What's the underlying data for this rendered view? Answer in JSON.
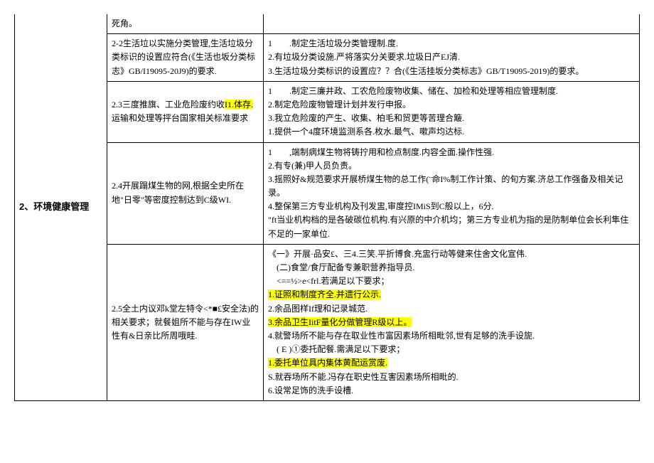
{
  "category": "2、环境健康管理",
  "rows": [
    {
      "left": "死角。",
      "right": ""
    },
    {
      "left": "2-2生活垃以实施分类管理,生活垃圾分类标识的设置应符合(《生活也坂分类标志》GB/I19095-20J9)的要求.",
      "right": "1　　.制定生活垃圾分类管理制.度.\n2.有垃圾分类设施.严将落实分关要求.垃圾日产EJ清.\n3.生活垃圾分类标识的设置应？？合(《生活挂坂分类标志》GB/T19095-2019)的要求。"
    },
    {
      "left_pre": "2.3三度推旗、工业危险废约收",
      "left_hl": "I1.体存.",
      "left_post": "运输和处理等抨台国家相关标准要求",
      "right": "1　　.制定三廉井政、工农危险废物收集、储在、加检和处理等相应管理制度.\n2.制定危险废物管理计划并发行申报。\n3.我立危险废的产生、收集、柏毛和贸更等苦理合簸.\n1.提供一个4度环境监测系各.枚水.最气、嗽声均达标."
    },
    {
      "left": "2.4开展蹋煤生物的网,根据全史所在地\"日零\"等密度控制达到C级WI.",
      "right": "1　　,端制病煤生物将铸拧用和检点制度.内容全面.操作性强.\n2.有专(兼)甲人员负责。\n3.摇照好&规范要求开展桥煤生物的总工作(¨命I%制工作计策、的旬方案.济总工作强备及相关记录。\n4.整保第三方专业机构及刊发盅,审度控IMiS到C般以上，6分.\n\"ft当业机构档的是各破碳位机构.有兴原的中介机均；第三方专业机为指的是防制单位会长利隼住不足的一家单位."
    },
    {
      "left": "2.5全土内议邓k堂左特令<*■£安全法)的相关要求；就餐姐所不能与存在IW业性有&日亲比所周哦畦.",
      "right_parts": [
        {
          "t": "plain",
          "v": "《一》开展·品安£、三4.三笑.平折博食.充盅行动等健来住舍文化宣伟."
        },
        {
          "t": "plain",
          "v": "　(二)食堂/食厅配备专兼职营养指导员."
        },
        {
          "t": "plain",
          "v": "　<==½>e<frl.若满足以下要求；"
        },
        {
          "t": "hl",
          "v": "1.证照和制度齐全.并遗行公示."
        },
        {
          "t": "plain",
          "v": "2.余品图样If理和记录城范."
        },
        {
          "t": "hl",
          "v": "3.余品卫生IitF量化分做管理R级以上。"
        },
        {
          "t": "plain",
          "v": "4.就警场所不能与存在取业性市富因素场所相毗邻,世有足够的洗手设旎."
        },
        {
          "t": "plain",
          "v": "　( E )①委托配餐.需满足以下要求；"
        },
        {
          "t": "hl",
          "v": "1.委托单位具内集体黄配运赏废."
        },
        {
          "t": "plain",
          "v": "S.就吞场所不能.冯存在职史性互害因素场所相毗的."
        },
        {
          "t": "plain",
          "v": "6.设常足饰的洗手设槽."
        }
      ]
    }
  ]
}
